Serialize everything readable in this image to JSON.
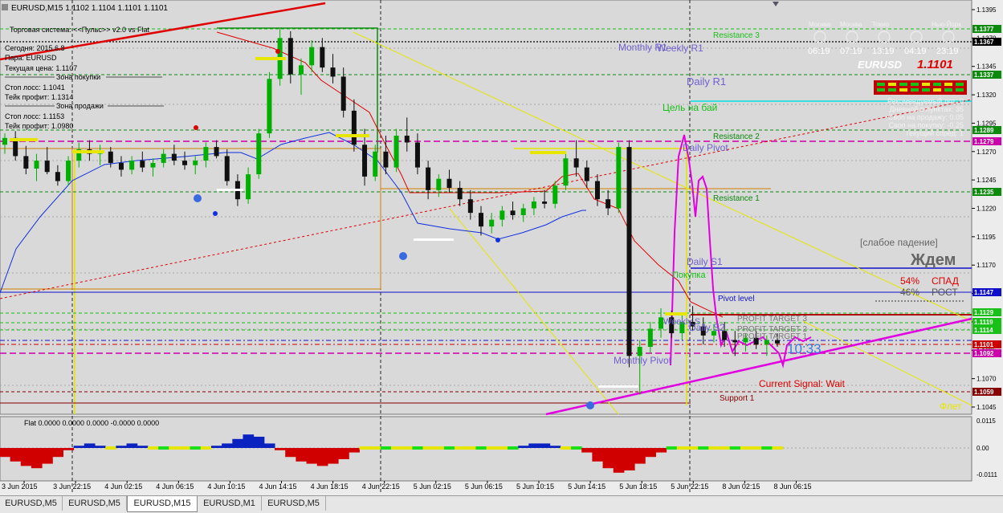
{
  "header": {
    "symbol_line": "EURUSD,M15  1.1102 1.1104 1.1101 1.1101"
  },
  "info_panel": {
    "system_title": "Торговая система: <<Пульс>> v2.0 vs Flat",
    "today": "Сегодня:  2015.6.8",
    "pair": "Пара:    EURUSD",
    "current_price": "Текущая цена: 1.1107",
    "buy_zone": "Зона покупки",
    "buy_stop": "Стоп лосс:        1.1041",
    "buy_take": "Тейк профит:    1.1314",
    "sell_zone": "Зона продажи",
    "sell_stop": "Стоп лосс:        1.1153",
    "sell_take": "Тейк профит:    1.0980"
  },
  "sessions": {
    "labels": [
      "Москва",
      "Москва",
      "Токио",
      "Нью-Йорк"
    ],
    "times": [
      "06:19",
      "07:19",
      "13:19",
      "04:19",
      "23:19"
    ]
  },
  "right_panel": {
    "symbol": "EURUSD",
    "price": "1.1101",
    "lines": [
      "Рекомендуемый лот: 0",
      "Дневной в пунктах: 35",
      "Своп на продажу: 0.05",
      "Своп на покупку: -0.25",
      "Текущий спред: 1"
    ]
  },
  "levels": {
    "resistance3": "Resistance 3",
    "monthly_r1": "Monthly R1",
    "weekly_r1": "Weekly R1",
    "daily_r1": "Daily R1",
    "target_buy": "Цель на бай",
    "resistance2": "Resistance 2",
    "daily_pivot": "Daily Pivot",
    "resistance1": "Resistance 1",
    "daily_s1": "Daily S1",
    "pokupka": "Покупка",
    "pivot_level": "Pivot level",
    "weekly_s": "Weekly S",
    "daily_s2": "Daily S2",
    "pt3": "PROFIT TARGET 3",
    "pt2": "PROFIT TARGET 2",
    "pt1": "PROFIT TARGET 1",
    "monthly_pivot": "Monthly Pivot",
    "current_signal": "Current Signal: Wait",
    "support1": "Support 1",
    "countdown": "10:33"
  },
  "signal_box": {
    "trend": "[слабое падение]",
    "wait": "Ждем",
    "pct_down": "54%",
    "down_label": "СПАД",
    "pct_up": "46%",
    "up_label": "РОСТ",
    "flat": "Флет"
  },
  "indicator": {
    "label": "Flat 0.0000 0.0000 0.0000 -0.0000 0.0000"
  },
  "price_axis": {
    "ticks": [
      "1.1395",
      "1.1370",
      "1.1345",
      "1.1320",
      "1.1295",
      "1.1270",
      "1.1245",
      "1.1220",
      "1.1195",
      "1.1170",
      "1.1145",
      "1.1120",
      "1.1095",
      "1.1070",
      "1.1045"
    ],
    "sub_ticks": [
      "0.0115",
      "0.00",
      "-0.0111"
    ],
    "markers": [
      {
        "text": "1.1377",
        "color": "#0c8a0c"
      },
      {
        "text": "1.1367",
        "color": "#000000"
      },
      {
        "text": "1.1337",
        "color": "#0c8a0c"
      },
      {
        "text": "1.1289",
        "color": "#0c8a0c"
      },
      {
        "text": "1.1279",
        "color": "#cc00aa"
      },
      {
        "text": "1.1235",
        "color": "#0c8a0c"
      },
      {
        "text": "1.1147",
        "color": "#1010cc"
      },
      {
        "text": "1.1129",
        "color": "#18c018"
      },
      {
        "text": "1.1119",
        "color": "#18c018"
      },
      {
        "text": "1.1114",
        "color": "#18c018"
      },
      {
        "text": "1.1101",
        "color": "#cc0000"
      },
      {
        "text": "1.1092",
        "color": "#cc00aa"
      },
      {
        "text": "1.1059",
        "color": "#880000"
      }
    ]
  },
  "time_axis": [
    "3 Jun 2015",
    "3 Jun 22:15",
    "4 Jun 02:15",
    "4 Jun 06:15",
    "4 Jun 10:15",
    "4 Jun 14:15",
    "4 Jun 18:15",
    "4 Jun 22:15",
    "5 Jun 02:15",
    "5 Jun 06:15",
    "5 Jun 10:15",
    "5 Jun 14:15",
    "5 Jun 18:15",
    "5 Jun 22:15",
    "8 Jun 02:15",
    "8 Jun 06:15"
  ],
  "tabs": [
    "EURUSD,M5",
    "EURUSD,M5",
    "EURUSD,M15",
    "EURUSD,M1",
    "EURUSD,M5"
  ],
  "active_tab": 2,
  "colors": {
    "bg": "#d9d9d9",
    "grid": "#b8b8b8",
    "bull": "#00b000",
    "bear": "#101010",
    "ma_red": "#e00000",
    "ma_blue": "#1030e0",
    "magenta": "#e000e0",
    "yellow": "#e6e600"
  },
  "candles": [
    [
      1.1276,
      1.1286,
      1.1268,
      1.1282
    ],
    [
      1.1282,
      1.1288,
      1.1262,
      1.1266
    ],
    [
      1.1266,
      1.1275,
      1.125,
      1.1255
    ],
    [
      1.1255,
      1.1268,
      1.1244,
      1.1262
    ],
    [
      1.1262,
      1.1274,
      1.125,
      1.1252
    ],
    [
      1.1252,
      1.1258,
      1.124,
      1.1244
    ],
    [
      1.1244,
      1.1266,
      1.124,
      1.1262
    ],
    [
      1.1262,
      1.1278,
      1.1256,
      1.1272
    ],
    [
      1.1272,
      1.128,
      1.1262,
      1.1268
    ],
    [
      1.1268,
      1.1276,
      1.1258,
      1.127
    ],
    [
      1.127,
      1.1274,
      1.1256,
      1.126
    ],
    [
      1.126,
      1.1266,
      1.1248,
      1.1254
    ],
    [
      1.1254,
      1.1266,
      1.125,
      1.1262
    ],
    [
      1.1262,
      1.127,
      1.1252,
      1.1256
    ],
    [
      1.1256,
      1.1264,
      1.1248,
      1.126
    ],
    [
      1.126,
      1.1272,
      1.1256,
      1.1268
    ],
    [
      1.1268,
      1.1276,
      1.1258,
      1.1262
    ],
    [
      1.1262,
      1.127,
      1.1254,
      1.1258
    ],
    [
      1.1258,
      1.1266,
      1.125,
      1.1262
    ],
    [
      1.1262,
      1.1278,
      1.1256,
      1.1274
    ],
    [
      1.1274,
      1.128,
      1.1264,
      1.1266
    ],
    [
      1.1266,
      1.1272,
      1.124,
      1.1244
    ],
    [
      1.1244,
      1.125,
      1.1222,
      1.1228
    ],
    [
      1.1228,
      1.1256,
      1.1224,
      1.125
    ],
    [
      1.125,
      1.129,
      1.1246,
      1.1286
    ],
    [
      1.1286,
      1.134,
      1.1282,
      1.1334
    ],
    [
      1.1334,
      1.1378,
      1.1328,
      1.137
    ],
    [
      1.137,
      1.1376,
      1.133,
      1.1338
    ],
    [
      1.1338,
      1.1352,
      1.132,
      1.1346
    ],
    [
      1.1346,
      1.1368,
      1.134,
      1.1362
    ],
    [
      1.1362,
      1.137,
      1.134,
      1.1344
    ],
    [
      1.1344,
      1.1356,
      1.133,
      1.1336
    ],
    [
      1.1336,
      1.1344,
      1.13,
      1.1306
    ],
    [
      1.1306,
      1.1316,
      1.127,
      1.1276
    ],
    [
      1.1276,
      1.129,
      1.124,
      1.1248
    ],
    [
      1.1248,
      1.1276,
      1.1244,
      1.127
    ],
    [
      1.127,
      1.1284,
      1.125,
      1.1256
    ],
    [
      1.1256,
      1.129,
      1.1252,
      1.1284
    ],
    [
      1.1284,
      1.13,
      1.127,
      1.1278
    ],
    [
      1.1278,
      1.1286,
      1.125,
      1.1256
    ],
    [
      1.1256,
      1.1262,
      1.1228,
      1.1236
    ],
    [
      1.1236,
      1.125,
      1.123,
      1.1246
    ],
    [
      1.1246,
      1.1254,
      1.1234,
      1.1238
    ],
    [
      1.1238,
      1.1244,
      1.1222,
      1.1228
    ],
    [
      1.1228,
      1.1236,
      1.121,
      1.1216
    ],
    [
      1.1216,
      1.1222,
      1.1196,
      1.1204
    ],
    [
      1.1204,
      1.1216,
      1.1198,
      1.121
    ],
    [
      1.121,
      1.1222,
      1.1204,
      1.1218
    ],
    [
      1.1218,
      1.1226,
      1.121,
      1.1214
    ],
    [
      1.1214,
      1.1224,
      1.1208,
      1.122
    ],
    [
      1.122,
      1.123,
      1.1214,
      1.1226
    ],
    [
      1.1226,
      1.1236,
      1.122,
      1.1224
    ],
    [
      1.1224,
      1.1244,
      1.122,
      1.124
    ],
    [
      1.124,
      1.1268,
      1.1236,
      1.1264
    ],
    [
      1.1264,
      1.128,
      1.1248,
      1.1256
    ],
    [
      1.1256,
      1.1262,
      1.1238,
      1.1244
    ],
    [
      1.1244,
      1.125,
      1.1222,
      1.1228
    ],
    [
      1.1228,
      1.1236,
      1.1214,
      1.122
    ],
    [
      1.122,
      1.1278,
      1.1216,
      1.1274
    ],
    [
      1.1274,
      1.128,
      1.108,
      1.109
    ],
    [
      1.109,
      1.1104,
      1.1056,
      1.1098
    ],
    [
      1.1098,
      1.112,
      1.1092,
      1.1114
    ],
    [
      1.1114,
      1.1132,
      1.1106,
      1.1124
    ],
    [
      1.1124,
      1.113,
      1.1106,
      1.111
    ],
    [
      1.111,
      1.1126,
      1.1104,
      1.112
    ],
    [
      1.112,
      1.1134,
      1.1112,
      1.1116
    ],
    [
      1.1116,
      1.1124,
      1.11,
      1.1108
    ],
    [
      1.1108,
      1.1118,
      1.1102,
      1.1112
    ],
    [
      1.1112,
      1.112,
      1.1098,
      1.1104
    ],
    [
      1.1104,
      1.1112,
      1.109,
      1.1102
    ],
    [
      1.1102,
      1.111,
      1.1094,
      1.1106
    ],
    [
      1.1106,
      1.1112,
      1.1096,
      1.11
    ],
    [
      1.11,
      1.1108,
      1.109,
      1.1104
    ],
    [
      1.1104,
      1.111,
      1.1098,
      1.1101
    ]
  ],
  "osc": [
    -0.004,
    -0.006,
    -0.008,
    -0.009,
    -0.007,
    -0.004,
    -0.001,
    0.001,
    0.002,
    0.001,
    0.0,
    0.001,
    0.002,
    0.001,
    0.0,
    0.0,
    0.0,
    0.0,
    0.0,
    0.0,
    0.001,
    0.002,
    0.004,
    0.006,
    0.005,
    0.002,
    -0.001,
    -0.004,
    -0.006,
    -0.007,
    -0.008,
    -0.007,
    -0.005,
    -0.002,
    0.0,
    0.0,
    0.0,
    0.0,
    0.0,
    0.0,
    0.0,
    0.0,
    0.0,
    0.0,
    0.0,
    0.0,
    0.0,
    0.0,
    0.0,
    0.001,
    0.002,
    0.002,
    0.001,
    0.0,
    0.0,
    -0.002,
    -0.006,
    -0.009,
    -0.011,
    -0.01,
    -0.007,
    -0.004,
    -0.002,
    0.0,
    0.0,
    0.0,
    0.0,
    0.0,
    0.0,
    0.0,
    0.0,
    0.0,
    0.0,
    0.0
  ]
}
